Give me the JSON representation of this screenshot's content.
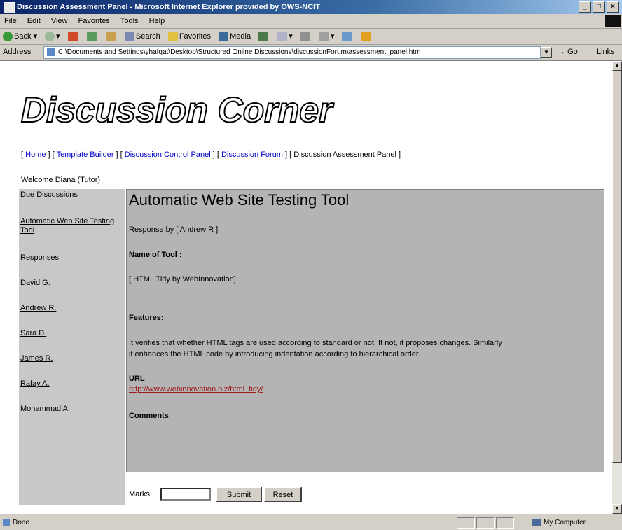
{
  "window": {
    "title": "Discussion Assessment Panel - Microsoft Internet Explorer provided by OWS-NCIT",
    "controls": [
      "_",
      "□",
      "×"
    ]
  },
  "menubar": [
    "File",
    "Edit",
    "View",
    "Favorites",
    "Tools",
    "Help"
  ],
  "toolbar": {
    "back": "Back",
    "search": "Search",
    "favorites": "Favorites",
    "media": "Media"
  },
  "address": {
    "label": "Address",
    "url": "C:\\Documents and Settings\\yhafqat\\Desktop\\Structured Online Discussions\\discussionForum\\assessment_panel.htm",
    "go": "Go",
    "links": "Links"
  },
  "page": {
    "logo": "Discussion Corner",
    "nav": {
      "home": "Home",
      "template_builder": "Template Builder",
      "control_panel": "Discussion Control Panel",
      "forum": "Discussion Forum",
      "assessment_panel": "Discussion Assessment Panel",
      "sep_open": "[ ",
      "sep_mid": " ] [ ",
      "sep_close": " ]"
    },
    "welcome": "Welcome Diana (Tutor)",
    "sidebar": {
      "due_heading": "Due Discussions",
      "due_link": "Automatic Web Site Testing Tool",
      "responses_heading": "Responses",
      "responses": [
        "David G.",
        "Andrew R.",
        "Sara D.",
        "James R.",
        "Rafay A.",
        "Mohammad A."
      ]
    },
    "main": {
      "heading": "Automatic Web Site Testing Tool",
      "response_by": "Response by [ Andrew R ]",
      "name_label": "Name of Tool :",
      "name_value": "[ HTML Tidy by WebInnovation]",
      "features_label": "Features:",
      "features_text_1": "It verifies that whether HTML tags are used according to standard or not. If not, it proposes changes. Similarly",
      "features_text_2": "it enhances the HTML code by introducing indentation according to hierarchical order.",
      "url_label": "URL",
      "url_value": "http://www.webinnovation.biz/html_tidy/",
      "comments_label": "Comments"
    },
    "form": {
      "marks_label": "Marks:",
      "marks_value": "",
      "submit": "Submit",
      "reset": "Reset"
    }
  },
  "status": {
    "left": "Done",
    "right": "My Computer"
  },
  "colors": {
    "titlebar": "#0a246a",
    "link": "#0000cc",
    "url_link": "#9c1a1a",
    "main_bg": "#b4b4b4",
    "sidebar_bg": "#c8c8c8"
  }
}
